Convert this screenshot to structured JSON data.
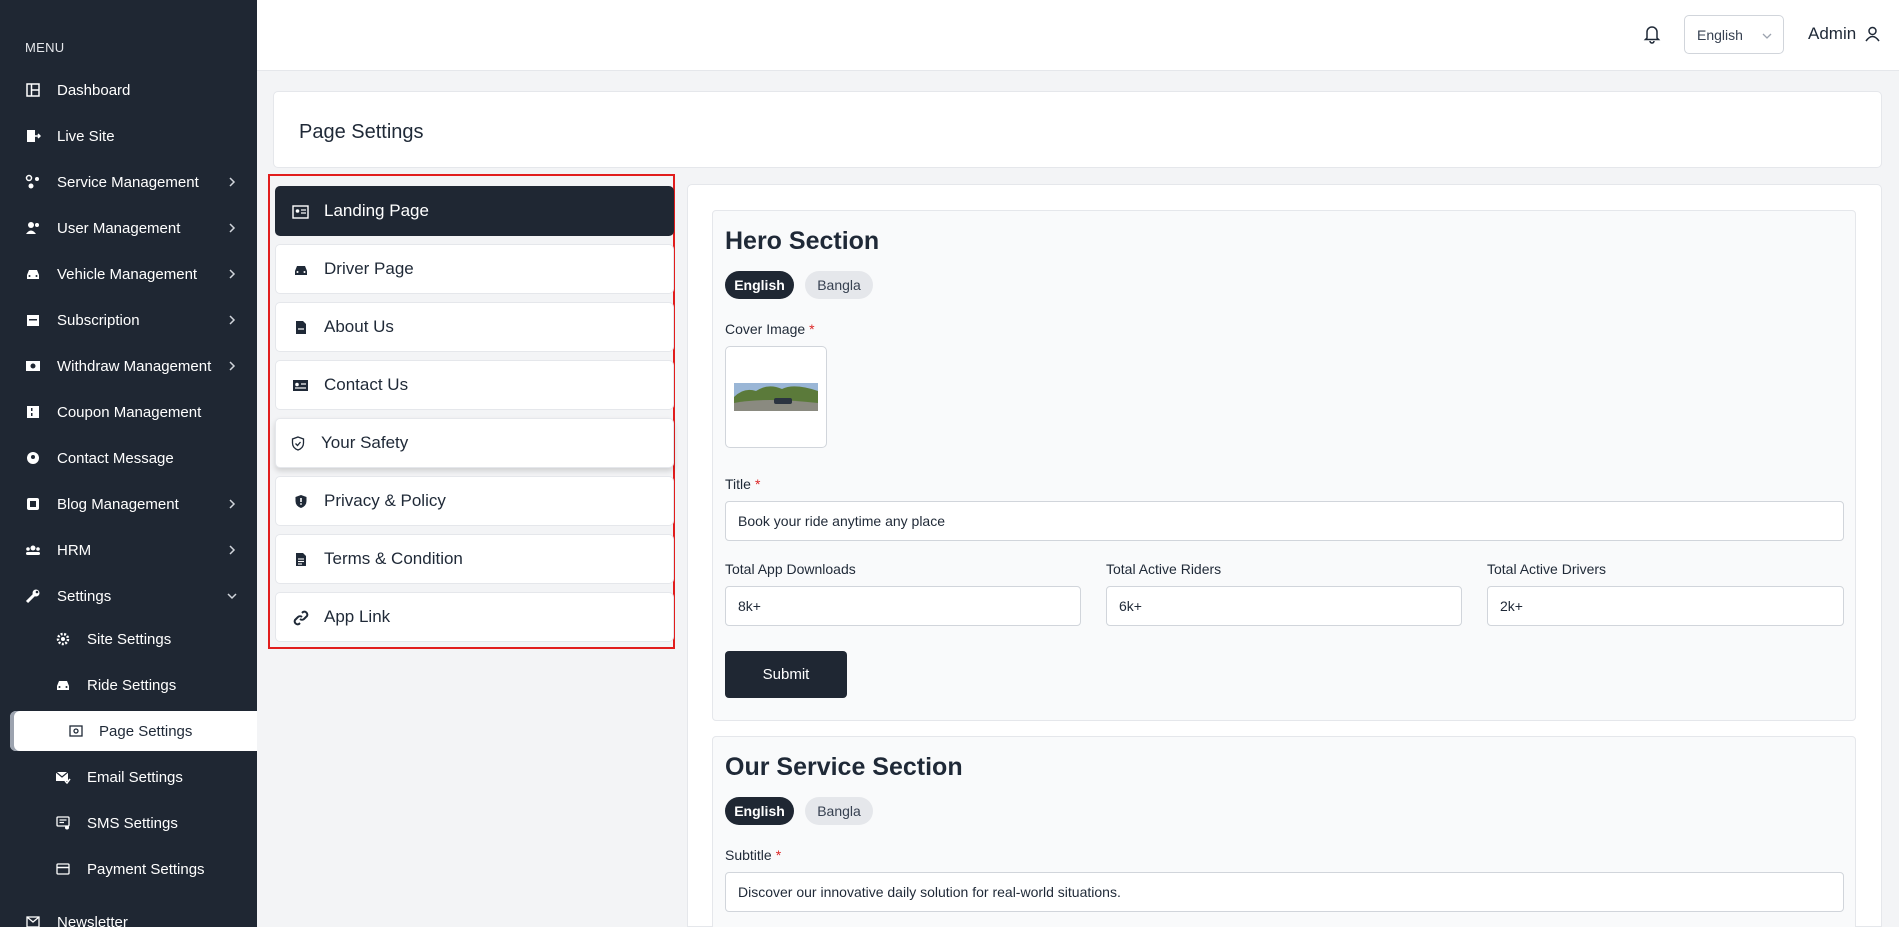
{
  "sidebar": {
    "menu_label": "MENU",
    "items": [
      {
        "label": "Dashboard",
        "icon": "dashboard-icon"
      },
      {
        "label": "Live Site",
        "icon": "live-site-icon"
      },
      {
        "label": "Service Management",
        "icon": "services-icon"
      },
      {
        "label": "User Management",
        "icon": "users-icon"
      },
      {
        "label": "Vehicle Management",
        "icon": "car-icon"
      },
      {
        "label": "Subscription",
        "icon": "calendar-icon"
      },
      {
        "label": "Withdraw Management",
        "icon": "money-icon"
      },
      {
        "label": "Coupon Management",
        "icon": "coupon-icon"
      },
      {
        "label": "Contact Message",
        "icon": "contact-icon"
      },
      {
        "label": "Blog Management",
        "icon": "blog-icon"
      },
      {
        "label": "HRM",
        "icon": "people-icon"
      },
      {
        "label": "Settings",
        "icon": "wrench-icon"
      },
      {
        "label": "Site Settings",
        "icon": "gear-icon"
      },
      {
        "label": "Ride Settings",
        "icon": "car-icon"
      },
      {
        "label": "Page Settings",
        "icon": "page-settings-icon"
      },
      {
        "label": "Email Settings",
        "icon": "mail-check-icon"
      },
      {
        "label": "SMS Settings",
        "icon": "sms-icon"
      },
      {
        "label": "Payment Settings",
        "icon": "credit-card-icon"
      },
      {
        "label": "Newsletter",
        "icon": "mail-icon"
      }
    ]
  },
  "topbar": {
    "language": "English",
    "user": "Admin"
  },
  "page": {
    "title": "Page Settings"
  },
  "tabs": [
    {
      "label": "Landing Page",
      "icon": "id-card-icon"
    },
    {
      "label": "Driver Page",
      "icon": "car-icon"
    },
    {
      "label": "About Us",
      "icon": "document-icon"
    },
    {
      "label": "Contact Us",
      "icon": "contact-card-icon"
    },
    {
      "label": "Your Safety",
      "icon": "shield-check-icon"
    },
    {
      "label": "Privacy & Policy",
      "icon": "shield-icon"
    },
    {
      "label": "Terms & Condition",
      "icon": "file-text-icon"
    },
    {
      "label": "App Link",
      "icon": "link-icon"
    }
  ],
  "hero": {
    "title": "Hero Section",
    "lang_english": "English",
    "lang_bangla": "Bangla",
    "cover_label": "Cover Image",
    "title_label": "Title",
    "title_value": "Book your ride anytime any place",
    "downloads_label": "Total App Downloads",
    "downloads_value": "8k+",
    "riders_label": "Total Active Riders",
    "riders_value": "6k+",
    "drivers_label": "Total Active Drivers",
    "drivers_value": "2k+",
    "submit": "Submit",
    "required_mark": "*"
  },
  "service": {
    "title": "Our Service Section",
    "lang_english": "English",
    "lang_bangla": "Bangla",
    "subtitle_label": "Subtitle",
    "subtitle_value": "Discover our innovative daily solution for real-world situations."
  },
  "colors": {
    "sidebar_bg": "#1f2733",
    "highlight_border": "#e11d1d",
    "required": "#dc2626"
  }
}
